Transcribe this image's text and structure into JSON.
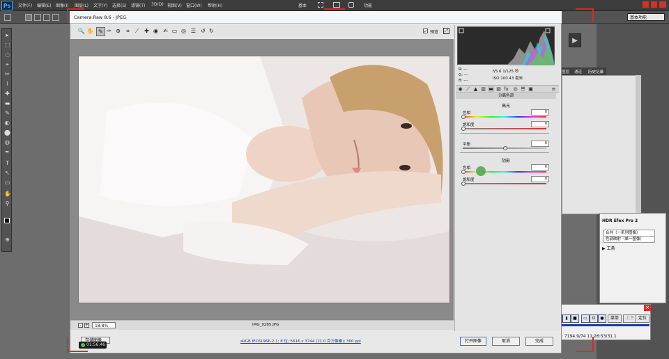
{
  "photoshop": {
    "logo": "Ps",
    "menus": [
      "文件(F)",
      "编辑(E)",
      "图像(I)",
      "图层(L)",
      "文字(Y)",
      "选择(S)",
      "滤镜(T)",
      "3D(D)",
      "视图(V)",
      "窗口(W)",
      "帮助(H)"
    ],
    "center_tabs": [
      "基本",
      "",
      "",
      "",
      "功能"
    ],
    "workspace": "基本功能",
    "dock_tabs": [
      "图层",
      "通道",
      "历史记录"
    ],
    "tools": [
      "▸",
      "⬚",
      "◌",
      "⌖",
      "✂",
      "⌇",
      "✚",
      "▬",
      "✎",
      "◐",
      "⬤",
      "◍",
      "✒",
      "T",
      "↖",
      "▭",
      "✋",
      "⚲",
      "■",
      "⊕"
    ]
  },
  "camera_raw": {
    "title": "Camera Raw 8.6 -  JPEG",
    "toolbar_icons": [
      "zoom-icon",
      "hand-icon",
      "white-balance-icon",
      "color-sampler-icon",
      "target-icon",
      "crop-icon",
      "straighten-icon",
      "spot-removal-icon",
      "red-eye-icon",
      "adjust-brush-icon",
      "graduated-filter-icon",
      "radial-filter-icon",
      "preferences-icon",
      "rotate-left-icon",
      "rotate-right-icon"
    ],
    "toolbar_glyphs": [
      "🔍",
      "✋",
      "✎",
      "✑",
      "⊕",
      "⌗",
      "⟋",
      "✚",
      "◉",
      "✍",
      "▭",
      "◎",
      "☰",
      "↺",
      "↻"
    ],
    "preview_label": "预览",
    "preview_checked": "✓",
    "zoom_level": "18.8%",
    "zoom_minus": "-",
    "zoom_plus": "+",
    "filename": "IMG_9285.JPG",
    "workflow": "sRGB IEC61966-2.1; 8 位; 5616 x 3744 (21.0 百万像素); 300 ppi",
    "buttons": {
      "save": "存储图像...",
      "open": "打开图像",
      "cancel": "取消",
      "done": "完成"
    },
    "recording_time": "01:56:46",
    "readout": {
      "r": "R:   ---",
      "g": "G:   ---",
      "b": "B:   ---"
    },
    "exif": {
      "line1": "f/5.6   1/125 秒",
      "line2": "ISO 100   43 毫米"
    },
    "panel_title": "分离色调",
    "highlights_title": "高光",
    "shadows_title": "阴影",
    "sliders": {
      "hl_hue": {
        "label": "色相",
        "value": "0",
        "level": 0.0
      },
      "hl_sat": {
        "label": "饱和度",
        "value": "0",
        "level": 0.0
      },
      "balance": {
        "label": "平衡",
        "value": "0",
        "level": 0.5
      },
      "sh_hue": {
        "label": "色相",
        "value": "0",
        "level": 0.0
      },
      "sh_sat": {
        "label": "饱和度",
        "value": "0",
        "level": 0.0
      }
    }
  },
  "hdr_efex": {
    "title": "HDR Efex Pro 2",
    "merge": "合并（一系列图像）",
    "tone_map": "色调映射（单一图像）",
    "tools": "▶ 工具"
  },
  "control": {
    "title": "控制",
    "menu": "菜单",
    "up": "上下",
    "locate": "定位",
    "close": "×",
    "timestamp": "时间: 7194.9/74 11:26:53/31.1"
  },
  "colors": {
    "recording_frame": "#e0281f",
    "histogram_bg": "#2b2b2b",
    "link": "#0b3aa6"
  }
}
